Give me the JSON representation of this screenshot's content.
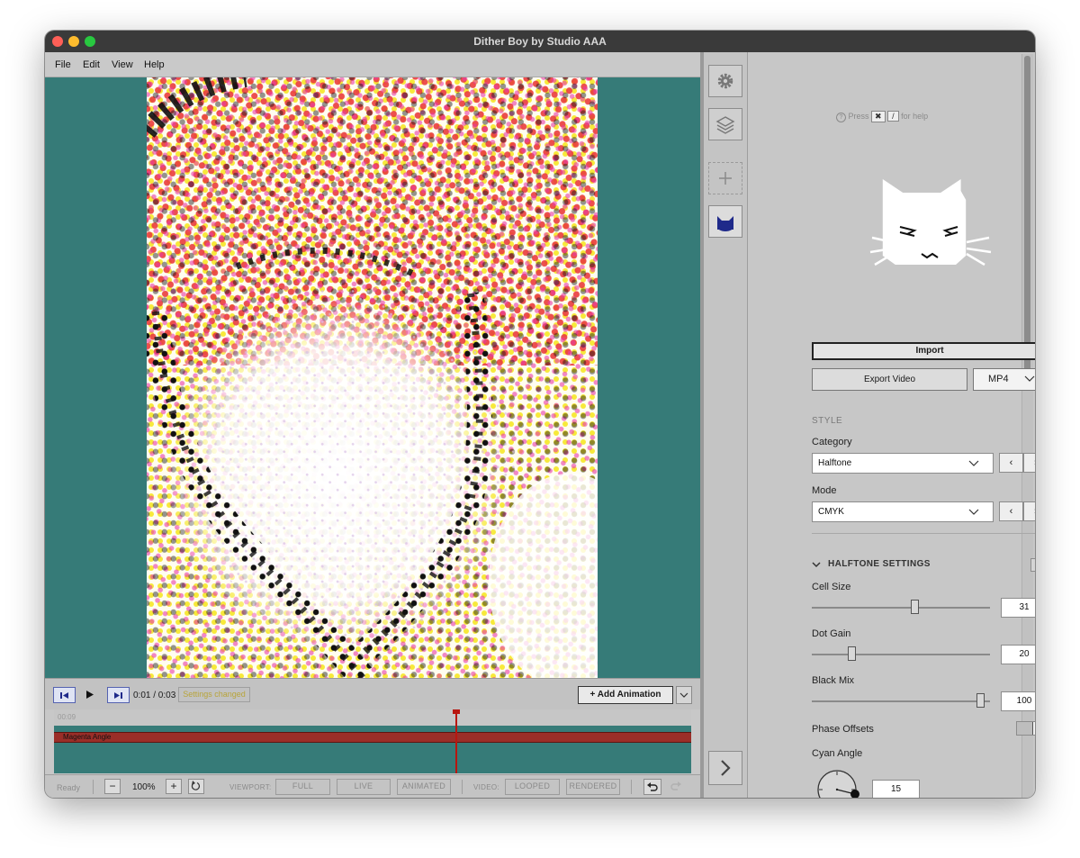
{
  "window": {
    "title": "Dither Boy by Studio AAA"
  },
  "menubar": {
    "items": [
      "File",
      "Edit",
      "View",
      "Help"
    ]
  },
  "transport": {
    "time": "0:01 / 0:03",
    "status_badge": "Settings changed",
    "add_animation_label": "Add Animation"
  },
  "timeline": {
    "ruler_label": "00:09",
    "track_label": "Magenta Angle",
    "playhead_fraction": 0.63
  },
  "statusbar": {
    "status": "Ready",
    "zoom": "100%",
    "viewport_label": "VIEWPORT:",
    "viewport_options": [
      "FULL",
      "LIVE",
      "ANIMATED"
    ],
    "video_label": "VIDEO:",
    "video_options": [
      "LOOPED",
      "RENDERED"
    ]
  },
  "help": {
    "press": "Press",
    "key1": "✖",
    "key2": "/",
    "suffix": "for help"
  },
  "panel": {
    "import_label": "Import",
    "export_label": "Export Video",
    "export_format": "MP4",
    "style_section": "STYLE",
    "category_label": "Category",
    "category_value": "Halftone",
    "mode_label": "Mode",
    "mode_value": "CMYK",
    "halftone_section": "HALFTONE SETTINGS",
    "cell_size_label": "Cell Size",
    "cell_size_value": "31",
    "dot_gain_label": "Dot Gain",
    "dot_gain_value": "20",
    "black_mix_label": "Black Mix",
    "black_mix_value": "100",
    "phase_offsets_label": "Phase Offsets",
    "cyan_angle_label": "Cyan Angle",
    "cyan_angle_value": "15"
  },
  "sliders": {
    "cell_size_fraction": 0.58,
    "dot_gain_fraction": 0.21,
    "black_mix_fraction": 0.97
  },
  "colors": {
    "canvas_bg": "#367b78",
    "track": "#9a2e28",
    "playhead": "#b8160f",
    "accent_blue": "#1f2a8a"
  },
  "icons": [
    "gear-icon",
    "layers-icon",
    "plus-icon",
    "cat-icon",
    "chevron-right-icon",
    "skip-back-icon",
    "play-icon",
    "skip-forward-icon",
    "undo-icon",
    "redo-icon",
    "reset-icon",
    "help-icon"
  ]
}
